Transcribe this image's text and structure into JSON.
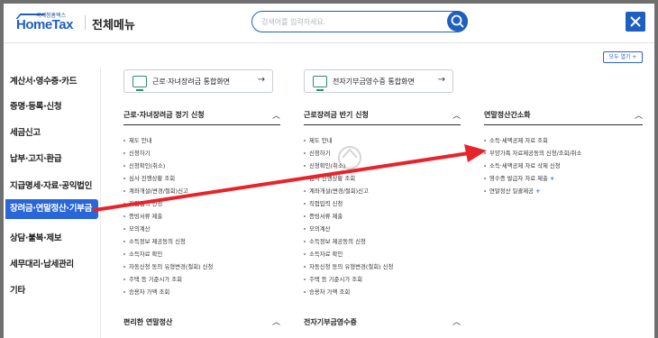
{
  "header": {
    "logo_small": "국세청홈택스",
    "logo_big": "HomeTax",
    "title": "전체메뉴",
    "search_placeholder": "검색어를 입력하세요."
  },
  "open_all": "모두 열기 +",
  "sidebar": {
    "items": [
      {
        "label": "계산서·영수증·카드"
      },
      {
        "label": "증명·등록·신청"
      },
      {
        "label": "세금신고"
      },
      {
        "label": "납부·고지·환급"
      },
      {
        "label": "지급명세·자료·공익법인"
      },
      {
        "label": "장려금·연말정산·기부금",
        "active": true
      },
      {
        "label": "상담·불복·제보"
      },
      {
        "label": "세무대리·납세관리"
      },
      {
        "label": "기타"
      }
    ]
  },
  "columns": [
    {
      "quick_button": "근로·자녀장려금 통합화면",
      "section_title": "근로·자녀장려금 정기 신청",
      "items": [
        "제도 안내",
        "신청하기",
        "신청확인(취소)",
        "심사 진행상황 조회",
        "계좌개설(변경/철회)신고",
        "직접입력 신청",
        "증빙서류 제출",
        "모의계산",
        "소득정보 제공동의 신청",
        "소득자료 확인",
        "자동신청 동의 유형변경(철회) 신청",
        "주택 등 기준시가 조회",
        "승용차 가액 조회"
      ],
      "bottom_title": "편리한 연말정산"
    },
    {
      "quick_button": "전자기부금영수증 통합화면",
      "section_title": "근로장려금 반기 신청",
      "items": [
        "제도 안내",
        "신청하기",
        "신청확인(취소)",
        "심사 진행상황 조회",
        "계좌개설(변경/철회)신고",
        "직접입력 신청",
        "증빙서류 제출",
        "모의계산",
        "소득정보 제공동의 신청",
        "소득자료 확인",
        "자동신청 동의 유형변경(철회) 신청",
        "주택 등 기준시가 조회",
        "승용차 가액 조회"
      ],
      "bottom_title": "전자기부금영수증"
    },
    {
      "section_title": "연말정산간소화",
      "items": [
        {
          "label": "소득·세액공제 자료 조회",
          "plus": false
        },
        {
          "label": "부양가족 자료제공동의 신청/조회/취소",
          "plus": false
        },
        {
          "label": "소득·세액공제 자료 삭제 신청",
          "plus": false
        },
        {
          "label": "영수증 발급자 자료 제출",
          "plus": true
        },
        {
          "label": "연말정산 일괄제공",
          "plus": true
        }
      ]
    }
  ],
  "annotation": {
    "color": "#e8232a"
  },
  "colors": {
    "accent": "#2966d8",
    "brand": "#1f5fbf"
  }
}
